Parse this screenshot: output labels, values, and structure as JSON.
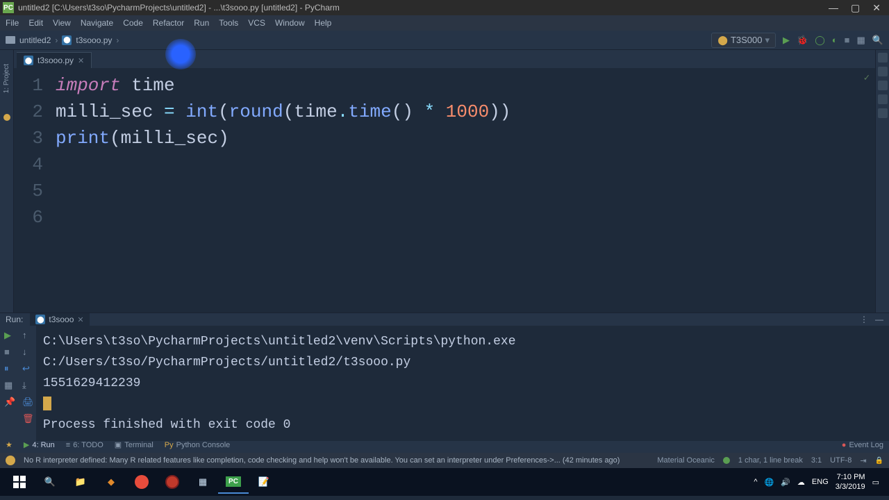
{
  "window": {
    "title": "untitled2 [C:\\Users\\t3so\\PycharmProjects\\untitled2] - ...\\t3sooo.py [untitled2] - PyCharm"
  },
  "menu": [
    "File",
    "Edit",
    "View",
    "Navigate",
    "Code",
    "Refactor",
    "Run",
    "Tools",
    "VCS",
    "Window",
    "Help"
  ],
  "breadcrumb": {
    "project": "untitled2",
    "file": "t3sooo.py"
  },
  "run_config": {
    "label": "T3S000"
  },
  "editor_tab": {
    "name": "t3sooo.py"
  },
  "line_numbers": [
    "1",
    "2",
    "3",
    "4",
    "5",
    "6"
  ],
  "code": {
    "l1": {
      "t1": "import",
      "t2": " time"
    },
    "l2": {
      "t1": "milli_sec ",
      "eq": "=",
      "sp": " ",
      "fn1": "int",
      "p1": "(",
      "fn2": "round",
      "p2": "(",
      "mod": "time",
      "dot": ".",
      "fn3": "time",
      "p3": "() ",
      "star": "*",
      "sp2": " ",
      "num": "1000",
      "p4": "))"
    },
    "l3": {
      "fn": "print",
      "p1": "(",
      "var": "milli_sec",
      "p2": ")"
    }
  },
  "left_gutter": {
    "project": "1: Project"
  },
  "run_panel": {
    "title": "Run:",
    "tab": "t3sooo",
    "output_cmd": "C:\\Users\\t3so\\PycharmProjects\\untitled2\\venv\\Scripts\\python.exe C:/Users/t3so/PycharmProjects/untitled2/t3sooo.py",
    "output_val": "1551629412239",
    "output_exit": "Process finished with exit code 0"
  },
  "bottom_tabs": {
    "run": "4: Run",
    "todo": "6: TODO",
    "terminal": "Terminal",
    "console": "Python Console",
    "eventlog": "Event Log"
  },
  "status": {
    "warn": "No R interpreter defined: Many R related features like completion, code checking and help won't be available. You can set an interpreter under Preferences->... (42 minutes ago)",
    "theme": "Material Oceanic",
    "sel": "1 char, 1 line break",
    "pos": "3:1",
    "encoding": "UTF-8",
    "indent_icon": "⇥"
  },
  "systray": {
    "up": "^",
    "net": "🌐",
    "vol": "🔊",
    "cloud": "☁",
    "lang": "ENG",
    "time": "7:10 PM",
    "date": "3/3/2019",
    "notif": "▭"
  },
  "colors": {
    "green": "#5a9e52",
    "red": "#d95757",
    "blue": "#4a8ad4"
  }
}
